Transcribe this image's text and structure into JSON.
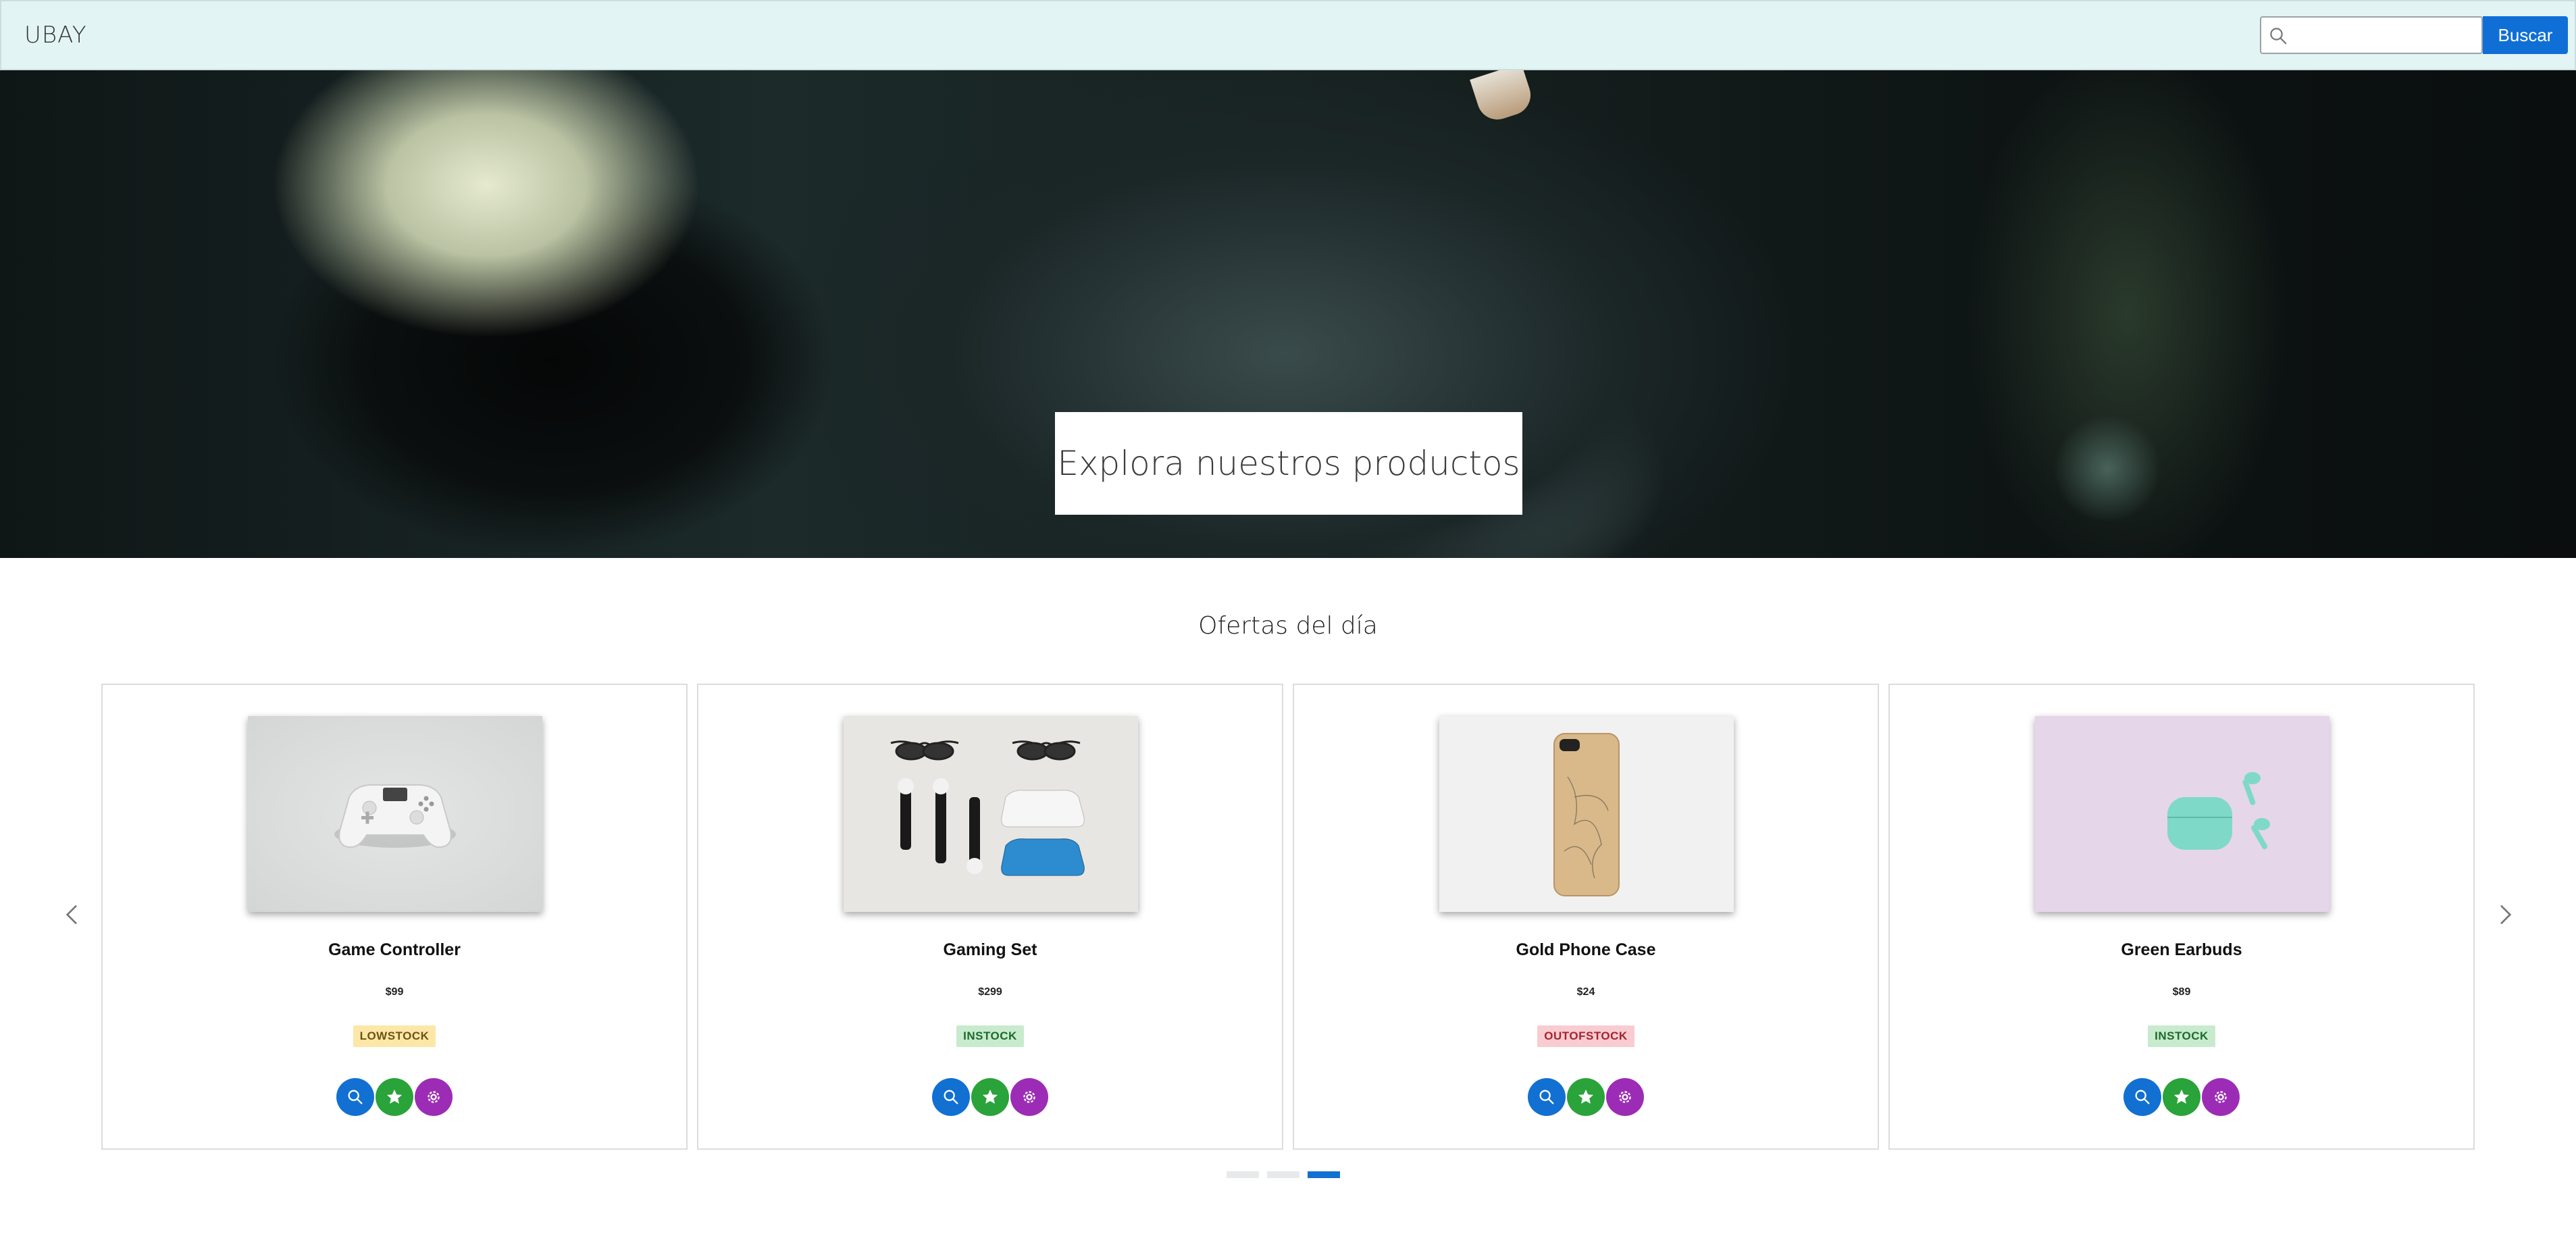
{
  "header": {
    "brand": "UBAY",
    "search": {
      "placeholder": "",
      "value": "",
      "icon": "search-icon"
    },
    "search_button": "Buscar",
    "accent": "#0f6fd6",
    "bar_color": "#e3f4f4"
  },
  "hero": {
    "title": "Explora nuestros productos"
  },
  "section": {
    "title": "Ofertas del día"
  },
  "carousel": {
    "prev_icon": "chevron-left-icon",
    "next_icon": "chevron-right-icon",
    "pages": 3,
    "active_page": 3,
    "products": [
      {
        "name": "Game Controller",
        "price": "$99",
        "stock": "LOWSTOCK",
        "image": "white-game-controller"
      },
      {
        "name": "Gaming Set",
        "price": "$299",
        "stock": "INSTOCK",
        "image": "gaming-set-flatlay"
      },
      {
        "name": "Gold Phone Case",
        "price": "$24",
        "stock": "OUTOFSTOCK",
        "image": "gold-phone-case"
      },
      {
        "name": "Green Earbuds",
        "price": "$89",
        "stock": "INSTOCK",
        "image": "mint-earbuds"
      }
    ],
    "actions": [
      {
        "icon": "search-icon",
        "color": "#1170d2"
      },
      {
        "icon": "star-icon",
        "color": "#29a33a"
      },
      {
        "icon": "cog-icon",
        "color": "#9c2cb5"
      }
    ]
  }
}
